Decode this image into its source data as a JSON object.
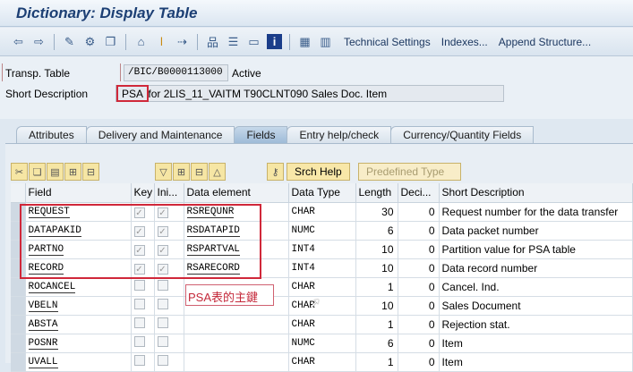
{
  "title": "Dictionary: Display Table",
  "toolbar": {
    "buttons": [
      "back-icon",
      "forward-icon",
      "display-change-icon",
      "active-inactive-icon",
      "other-object-icon",
      "where-used-icon",
      "info-icon",
      "navigate-icon",
      "hierarchy-icon",
      "stack-icon",
      "object-list-icon",
      "help-icon",
      "layout-icon",
      "grid-icon"
    ],
    "technical_settings": "Technical Settings",
    "indexes": "Indexes...",
    "append_structure": "Append Structure..."
  },
  "header": {
    "table_label": "Transp. Table",
    "table_name": "/BIC/B0000113000",
    "status": "Active",
    "desc_label": "Short Description",
    "desc_highlight": "PSA",
    "desc_rest": "for 2LIS_11_VAITM T90CLNT090 Sales Doc. Item"
  },
  "tabs": [
    "Attributes",
    "Delivery and Maintenance",
    "Fields",
    "Entry help/check",
    "Currency/Quantity Fields"
  ],
  "table_toolbar": {
    "srch_help": "Srch Help",
    "predefined_type": "Predefined Type"
  },
  "columns": [
    "Field",
    "Key",
    "Ini...",
    "Data element",
    "Data Type",
    "Length",
    "Deci...",
    "Short Description"
  ],
  "rows": [
    {
      "field": "REQUEST",
      "key": true,
      "ini": true,
      "element": "RSREQUNR",
      "type": "CHAR",
      "length": "30",
      "dec": "0",
      "desc": "Request number for the data transfer"
    },
    {
      "field": "DATAPAKID",
      "key": true,
      "ini": true,
      "element": "RSDATAPID",
      "type": "NUMC",
      "length": "6",
      "dec": "0",
      "desc": "Data packet number"
    },
    {
      "field": "PARTNO",
      "key": true,
      "ini": true,
      "element": "RSPARTVAL",
      "type": "INT4",
      "length": "10",
      "dec": "0",
      "desc": "Partition value for PSA table"
    },
    {
      "field": "RECORD",
      "key": true,
      "ini": true,
      "element": "RSARECORD",
      "type": "INT4",
      "length": "10",
      "dec": "0",
      "desc": "Data record number"
    },
    {
      "field": "ROCANCEL",
      "key": false,
      "ini": false,
      "element": "",
      "type": "CHAR",
      "length": "1",
      "dec": "0",
      "desc": "Cancel. Ind."
    },
    {
      "field": "VBELN",
      "key": false,
      "ini": false,
      "element": "",
      "type": "CHAR",
      "length": "10",
      "dec": "0",
      "desc": "Sales Document"
    },
    {
      "field": "ABSTA",
      "key": false,
      "ini": false,
      "element": "",
      "type": "CHAR",
      "length": "1",
      "dec": "0",
      "desc": "Rejection stat."
    },
    {
      "field": "POSNR",
      "key": false,
      "ini": false,
      "element": "",
      "type": "NUMC",
      "length": "6",
      "dec": "0",
      "desc": "Item"
    },
    {
      "field": "UVALL",
      "key": false,
      "ini": false,
      "element": "",
      "type": "CHAR",
      "length": "1",
      "dec": "0",
      "desc": "Item"
    }
  ],
  "annotation": "PSA表的主鍵",
  "colors": {
    "highlight": "#d0283a",
    "title": "#1c3f74"
  }
}
